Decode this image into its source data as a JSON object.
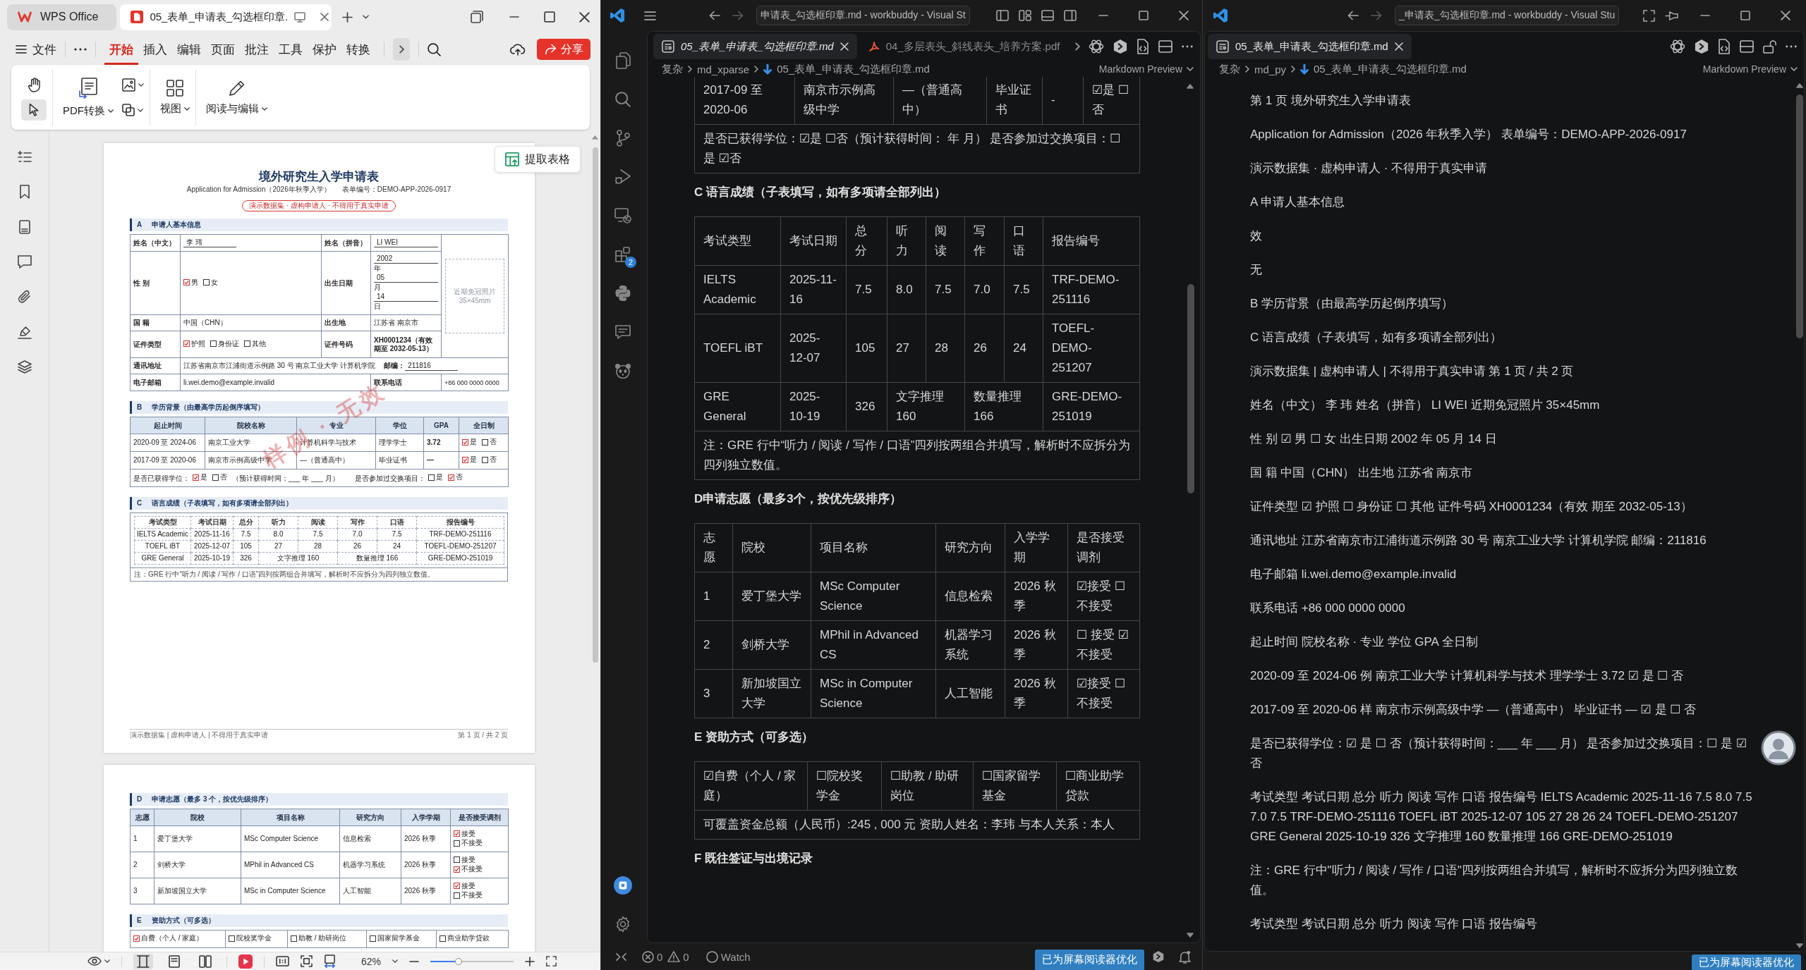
{
  "wps": {
    "tabs": [
      {
        "kind": "home",
        "label": "WPS Office",
        "selected": false
      },
      {
        "kind": "pdf",
        "label": "05_表单_申请表_勾选框印章.",
        "selected": true
      }
    ],
    "file_menu": "文件",
    "ribbon_tabs": [
      {
        "label": "开始",
        "selected": true
      },
      {
        "label": "插入",
        "selected": false
      },
      {
        "label": "编辑",
        "selected": false
      },
      {
        "label": "页面",
        "selected": false
      },
      {
        "label": "批注",
        "selected": false
      },
      {
        "label": "工具",
        "selected": false
      },
      {
        "label": "保护",
        "selected": false
      },
      {
        "label": "转换",
        "selected": false
      }
    ],
    "share": "分享",
    "tools": [
      {
        "kind": "hand",
        "selected": false
      },
      {
        "kind": "select",
        "selected": true
      }
    ],
    "buttons": [
      {
        "kind": "pdf",
        "label": "PDF转换"
      },
      {
        "kind": "view",
        "label": "视图"
      },
      {
        "kind": "edit",
        "label": "阅读与编辑"
      }
    ],
    "extract_button": "提取表格",
    "view_modes": [
      {
        "kind": "continuous",
        "selected": true
      },
      {
        "kind": "single",
        "selected": false
      },
      {
        "kind": "double",
        "selected": false
      }
    ],
    "zoom": {
      "value": "62%",
      "level": 0.32
    }
  },
  "document": {
    "pages": [
      {
        "title": "境外研究生入学申请表",
        "subtitle": "Application for Admission（2026年秋季入学）",
        "form_number": "表单编号：DEMO-APP-2026-0917",
        "notice": "演示数据集 · 虚构申请人 · 不得用于真实申请",
        "watermark": "样例 · 无效",
        "sections": [
          {
            "kind": "fields",
            "letter": "A",
            "title": "申请人基本信息",
            "name_cn": {
              "label": "姓名（中文）",
              "value": "李 玮"
            },
            "name_pinyin": {
              "label": "姓名（拼音）",
              "value": "LI WEI"
            },
            "photo": {
              "caption": "近期免冠照片",
              "size": "35×45mm"
            },
            "gender": {
              "label": "性 别",
              "options": [
                {
                  "label": "男",
                  "checked": true
                },
                {
                  "label": "女",
                  "checked": false
                }
              ]
            },
            "birth_date": {
              "label": "出生日期",
              "parts": [
                {
                  "value": "2002",
                  "unit": "年"
                },
                {
                  "value": "05",
                  "unit": "月"
                },
                {
                  "value": "14",
                  "unit": "日"
                }
              ]
            },
            "nationality": {
              "label": "国 籍",
              "value": "中国（CHN）"
            },
            "birthplace": {
              "label": "出生地",
              "value": "江苏省 南京市"
            },
            "id_type": {
              "label": "证件类型",
              "options": [
                {
                  "label": "护照",
                  "checked": true
                },
                {
                  "label": "身份证",
                  "checked": false
                },
                {
                  "label": "其他",
                  "checked": false
                }
              ]
            },
            "id_number": {
              "label": "证件号码",
              "value": "XH0001234（有效期至 2032-05-13）"
            },
            "address": {
              "label": "通讯地址",
              "value": "江苏省南京市江浦街道示例路 30 号 南京工业大学 计算机学院",
              "postcode_label": "邮编：",
              "postcode": "211816"
            },
            "email": {
              "label": "电子邮箱",
              "value": "li.wei.demo@example.invalid"
            },
            "phone": {
              "label": "联系电话",
              "value": "+86 000 0000 0000"
            }
          },
          {
            "kind": "education",
            "letter": "B",
            "title": "学历背景（由最高学历起倒序填写）",
            "columns": [
              "起止时间",
              "院校名称",
              "专业",
              "学位",
              "GPA",
              "全日制"
            ],
            "rows": [
              {
                "cells": [
                  "2020-09 至 2024-06",
                  "南京工业大学",
                  "计算机科学与技术",
                  "理学学士",
                  "3.72"
                ],
                "full_time": [
                  {
                    "label": "是",
                    "checked": true
                  },
                  {
                    "label": "否",
                    "checked": false
                  }
                ]
              },
              {
                "cells": [
                  "2017-09 至 2020-06",
                  "南京市示例高级中学",
                  "—（普通高中）",
                  "毕业证书",
                  "—"
                ],
                "full_time": [
                  {
                    "label": "是",
                    "checked": true
                  },
                  {
                    "label": "否",
                    "checked": false
                  }
                ]
              }
            ],
            "footer": [
              {
                "kind": "text",
                "text": "是否已获得学位："
              },
              {
                "kind": "check",
                "label": "是",
                "checked": true
              },
              {
                "kind": "check",
                "label": "否",
                "checked": false
              },
              {
                "kind": "text",
                "text": "（预计获得时间：___ 年 ___ 月）"
              },
              {
                "kind": "text",
                "text": "是否参加过交换项目："
              },
              {
                "kind": "check",
                "label": "是",
                "checked": false
              },
              {
                "kind": "check",
                "label": "否",
                "checked": true
              }
            ]
          },
          {
            "kind": "scores",
            "letter": "C",
            "title": "语言成绩（子表填写，如有多项请全部列出）",
            "columns": [
              "考试类型",
              "考试日期",
              "总分",
              "听力",
              "阅读",
              "写作",
              "口语",
              "报告编号"
            ],
            "rows": [
              {
                "cells": [
                  "IELTS Academic",
                  "2025-11-16",
                  "7.5",
                  "8.0",
                  "7.5",
                  "7.0",
                  "7.5",
                  "TRF-DEMO-251116"
                ]
              },
              {
                "cells": [
                  "TOEFL iBT",
                  "2025-12-07",
                  "105",
                  "27",
                  "28",
                  "26",
                  "24",
                  "TOEFL-DEMO-251207"
                ]
              },
              {
                "cells": [
                  {
                    "text": "GRE General"
                  },
                  {
                    "text": "2025-10-19"
                  },
                  {
                    "text": "326"
                  },
                  {
                    "text": "文字推理 160",
                    "colspan": 2
                  },
                  {
                    "text": "数量推理 166",
                    "colspan": 2
                  },
                  {
                    "text": "GRE-DEMO-251019"
                  }
                ]
              }
            ],
            "note": "注：GRE 行中“听力 / 阅读 / 写作 / 口语”四列按两组合并填写，解析时不应拆分为四列独立数值。"
          }
        ],
        "footer_left": "演示数据集 | 虚构申请人 | 不得用于真实申请",
        "footer_right": "第 1 页 / 共 2 页"
      },
      {
        "sections": [
          {
            "kind": "choices",
            "letter": "D",
            "title": "申请志愿（最多 3 个，按优先级排序）",
            "columns": [
              "志愿",
              "院校",
              "项目名称",
              "研究方向",
              "入学学期",
              "是否接受调剂"
            ],
            "rows": [
              {
                "cells": [
                  "1",
                  "爱丁堡大学",
                  "MSc Computer Science",
                  "信息检索",
                  "2026 秋季"
                ],
                "adjust": [
                  {
                    "label": "接受",
                    "checked": true
                  },
                  {
                    "label": "不接受",
                    "checked": false
                  }
                ]
              },
              {
                "cells": [
                  "2",
                  "剑桥大学",
                  "MPhil in Advanced CS",
                  "机器学习系统",
                  "2026 秋季"
                ],
                "adjust": [
                  {
                    "label": "接受",
                    "checked": false
                  },
                  {
                    "label": "不接受",
                    "checked": true
                  }
                ]
              },
              {
                "cells": [
                  "3",
                  "新加坡国立大学",
                  "MSc in Computer Science",
                  "人工智能",
                  "2026 秋季"
                ],
                "adjust": [
                  {
                    "label": "接受",
                    "checked": true
                  },
                  {
                    "label": "不接受",
                    "checked": false
                  }
                ]
              }
            ]
          },
          {
            "kind": "funding",
            "letter": "E",
            "title": "资助方式（可多选）",
            "options": [
              {
                "label": "自费（个人 / 家庭）",
                "checked": true
              },
              {
                "label": "院校奖学金",
                "checked": false
              },
              {
                "label": "助教 / 助研岗位",
                "checked": false
              },
              {
                "label": "国家留学基金",
                "checked": false
              },
              {
                "label": "商业助学贷款",
                "checked": false
              }
            ]
          }
        ]
      }
    ]
  },
  "editor_left": {
    "title": "申请表_勾选框印章.md - workbuddy - Visual St",
    "extensions_badge": "2",
    "tabs": [
      {
        "kind": "markdown",
        "label": "05_表单_申请表_勾选框印章.md",
        "selected": true,
        "preview": true
      },
      {
        "kind": "pdf",
        "label": "04_多层表头_斜线表头_培养方案.pdf",
        "selected": false,
        "preview": false
      }
    ],
    "breadcrumb": [
      "复杂",
      "md_xparse",
      "05_表单_申请表_勾选框印章.md"
    ],
    "view_menu": "Markdown Preview",
    "education_tail": {
      "cells": [
        "2017-09 至 2020-06",
        "南京市示例高级中学",
        "—（普通高中）",
        "毕业证书",
        "-",
        "☑是 ☐否"
      ],
      "note": "是否已获得学位：☑是 ☐否（预计获得时间： 年 月） 是否参加过交换项目：☐是 ☑否"
    },
    "heading_c": "C 语言成绩（子表填写，如有多项请全部列出）",
    "table_c": {
      "columns": [
        "考试类型",
        "考试日期",
        "总分",
        "听力",
        "阅读",
        "写作",
        "口语",
        "报告编号"
      ],
      "rows": [
        {
          "cells": [
            "IELTS Academic",
            "2025-11-16",
            "7.5",
            "8.0",
            "7.5",
            "7.0",
            "7.5",
            "TRF-DEMO-251116"
          ]
        },
        {
          "cells": [
            "TOEFL iBT",
            "2025-12-07",
            "105",
            "27",
            "28",
            "26",
            "24",
            "TOEFL-DEMO-251207"
          ]
        },
        {
          "cells": [
            {
              "text": "GRE General"
            },
            {
              "text": "2025-10-19"
            },
            {
              "text": "326"
            },
            {
              "text": "文字推理 160",
              "colspan": 2
            },
            {
              "text": "数量推理 166",
              "colspan": 2
            },
            {
              "text": "GRE-DEMO-251019"
            }
          ]
        }
      ],
      "note": "注：GRE 行中“听力 / 阅读 / 写作 / 口语”四列按两组合并填写，解析时不应拆分为四列独立数值。"
    },
    "heading_d": "D申请志愿（最多3个，按优先级排序）",
    "table_d": {
      "columns": [
        "志愿",
        "院校",
        "项目名称",
        "研究方向",
        "入学学期",
        "是否接受调剂"
      ],
      "rows": [
        [
          "1",
          "爱丁堡大学",
          "MSc Computer Science",
          "信息检索",
          "2026 秋季",
          "☑接受 ☐不接受"
        ],
        [
          "2",
          "剑桥大学",
          "MPhil in Advanced CS",
          "机器学习系统",
          "2026 秋季",
          "☐ 接受 ☑不接受"
        ],
        [
          "3",
          "新加坡国立大学",
          "MSc in Computer Science",
          "人工智能",
          "2026 秋季",
          "☑接受 ☐不接受"
        ]
      ]
    },
    "heading_e": "E 资助方式（可多选）",
    "table_e": {
      "options": [
        "☑自费（个人 / 家庭）",
        "☐院校奖学金",
        "☐助教 / 助研岗位",
        "☐国家留学基金",
        "☐商业助学贷款"
      ],
      "note": "可覆盖资金总额（人民币）:245 , 000 元 资助人姓名：李玮 与本人关系：本人"
    },
    "heading_f": "F 既往签证与出境记录",
    "status": {
      "errors": "0",
      "warnings": "0",
      "watch": "Watch",
      "screen_reader": "已为屏幕阅读器优化"
    }
  },
  "editor_right": {
    "title": "_申请表_勾选框印章.md - workbuddy - Visual Stu",
    "tabs": [
      {
        "kind": "markdown",
        "label": "05_表单_申请表_勾选框印章.md",
        "selected": true,
        "preview": false
      }
    ],
    "breadcrumb": [
      "复杂",
      "md_py",
      "05_表单_申请表_勾选框印章.md"
    ],
    "view_menu": "Markdown Preview",
    "paragraphs": [
      "第 1 页 境外研究生入学申请表",
      "Application for Admission（2026 年秋季入学） 表单编号：DEMO-APP-2026-0917",
      "演示数据集 · 虚构申请人 · 不得用于真实申请",
      "A 申请人基本信息",
      "效",
      "无",
      "B 学历背景（由最高学历起倒序填写）",
      "C 语言成绩（子表填写，如有多项请全部列出）",
      "演示数据集 | 虚构申请人 | 不得用于真实申请 第 1 页 / 共 2 页",
      "姓名（中文） 李 玮 姓名（拼音） LI WEI 近期免冠照片 35×45mm",
      "性 别 ☑ 男 ☐ 女 出生日期 2002 年 05 月 14 日",
      "国 籍 中国（CHN） 出生地 江苏省 南京市",
      "证件类型 ☑ 护照 ☐ 身份证 ☐ 其他 证件号码 XH0001234（有效 期至 2032-05-13）",
      "通讯地址 江苏省南京市江浦街道示例路 30 号 南京工业大学 计算机学院 邮编：211816",
      "电子邮箱 li.wei.demo@example.invalid",
      "联系电话 +86 000 0000 0000",
      "起止时间 院校名称 · 专业 学位 GPA 全日制",
      "2020-09 至 2024-06 例 南京工业大学 计算机科学与技术 理学学士 3.72 ☑ 是 ☐ 否",
      "2017-09 至 2020-06 样 南京市示例高级中学 —（普通高中） 毕业证书 — ☑ 是 ☐ 否",
      "是否已获得学位：☑ 是 ☐ 否（预计获得时间：___ 年 ___ 月） 是否参加过交换项目：☐ 是 ☑ 否",
      "考试类型 考试日期 总分 听力 阅读 写作 口语 报告编号 IELTS Academic 2025-11-16 7.5 8.0 7.5 7.0 7.5 TRF-DEMO-251116 TOEFL iBT 2025-12-07 105 27 28 26 24 TOEFL-DEMO-251207 GRE General 2025-10-19 326 文字推理 160 数量推理 166 GRE-DEMO-251019",
      "注：GRE 行中\"听力 / 阅读 / 写作 / 口语\"四列按两组合并填写，解析时不应拆分为四列独立数值。",
      "考试类型 考试日期 总分 听力 阅读 写作 口语 报告编号"
    ],
    "status": {
      "screen_reader": "已为屏幕阅读器优化"
    }
  }
}
